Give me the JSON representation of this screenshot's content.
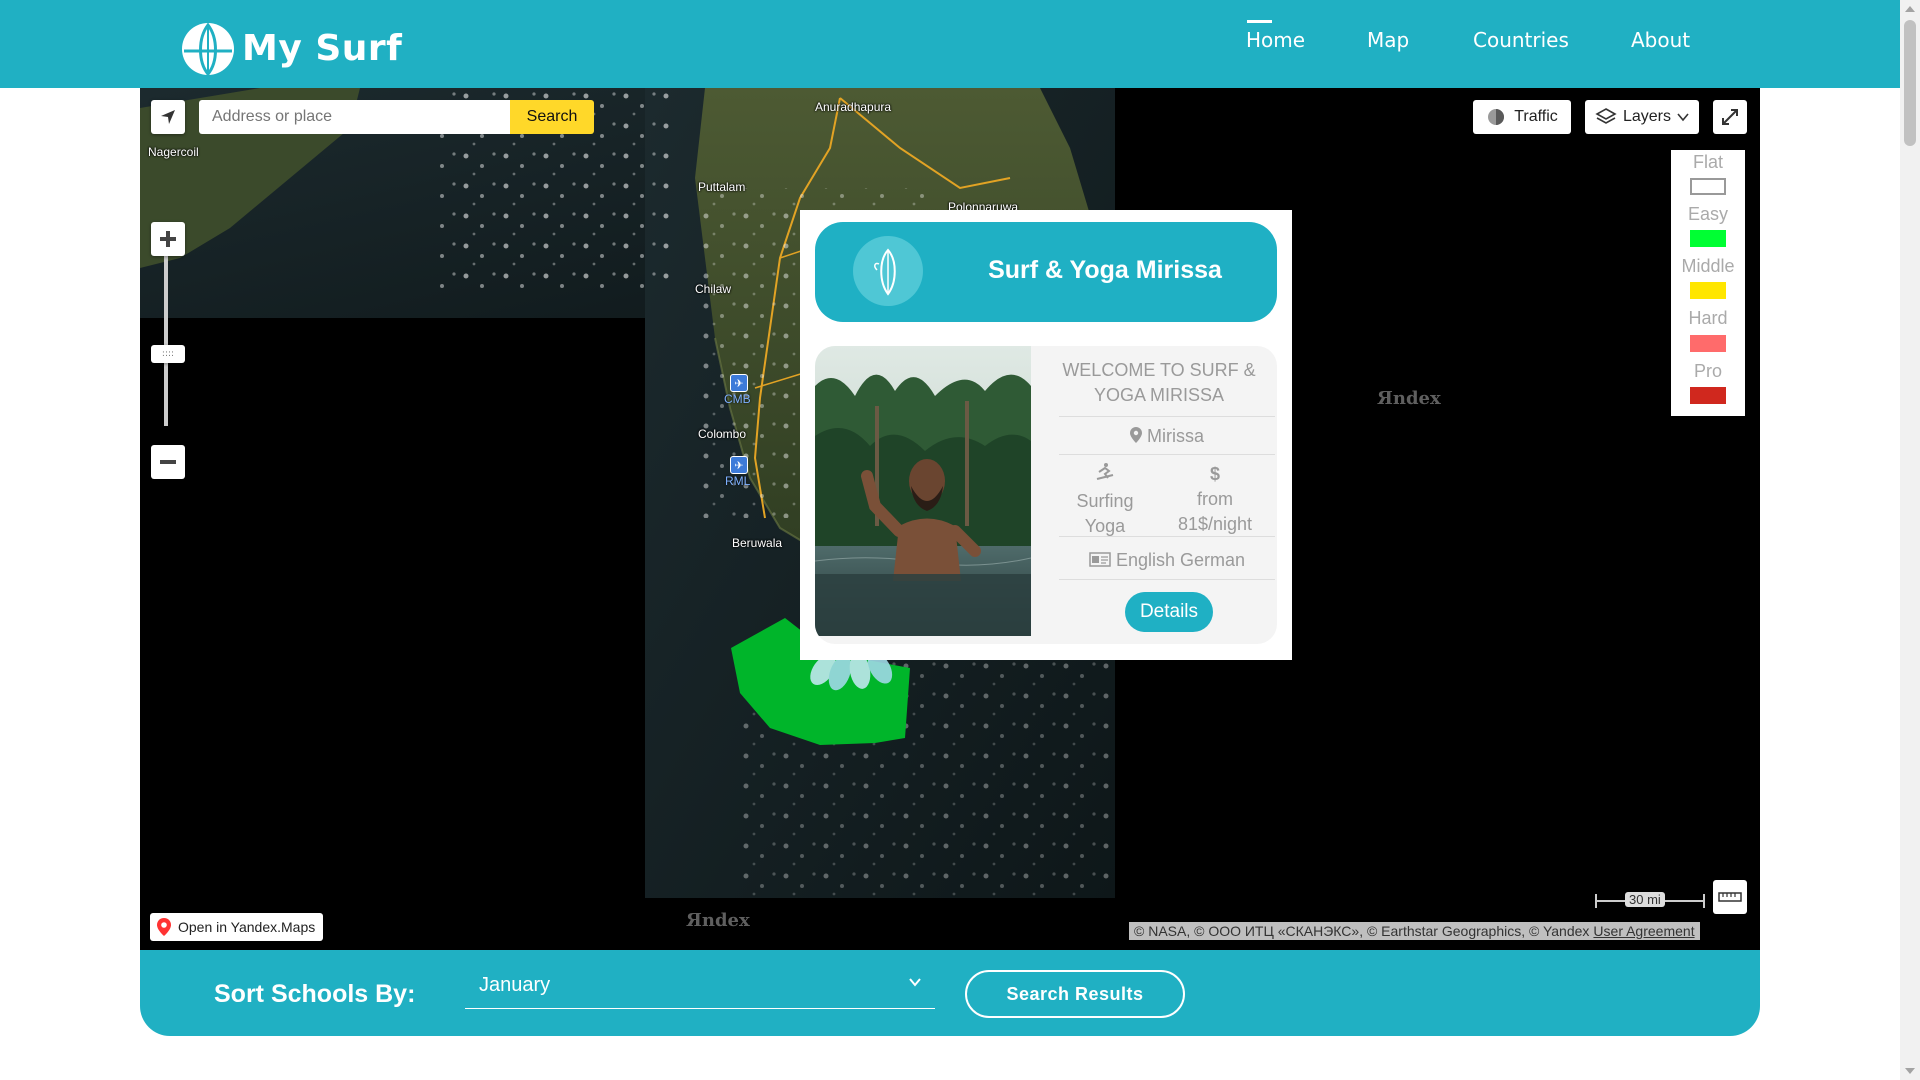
{
  "header": {
    "logo_text": "My Surf",
    "nav": [
      {
        "label": "Home",
        "active": true
      },
      {
        "label": "Map"
      },
      {
        "label": "Countries"
      },
      {
        "label": "About"
      }
    ]
  },
  "map": {
    "search": {
      "placeholder": "Address or place",
      "button_label": "Search"
    },
    "traffic_label": "Traffic",
    "layers_label": "Layers",
    "place_labels": {
      "anuradhapura": "Anuradhapura",
      "nagercoil": "Nagercoil",
      "puttalam": "Puttalam",
      "polonnaruwa": "Polonnaruwa",
      "chilaw": "Chilaw",
      "colombo": "Colombo",
      "beruwala": "Beruwala"
    },
    "airports": [
      "CMB",
      "RML"
    ],
    "legend": [
      {
        "label": "Flat",
        "color": "#ffffff"
      },
      {
        "label": "Easy",
        "color": "#00ff33"
      },
      {
        "label": "Middle",
        "color": "#ffe600"
      },
      {
        "label": "Hard",
        "color": "#ff6b6b"
      },
      {
        "label": "Pro",
        "color": "#d0281e"
      }
    ],
    "watermark": "Яndex",
    "scale_label": "30 mi",
    "open_in_yandex": "Open in Yandex.Maps",
    "copyright": "© NASA, © ООО ИТЦ «СКАНЭКС», © Earthstar Geographics, © Yandex",
    "user_agreement": "User Agreement"
  },
  "popup": {
    "title": "Surf & Yoga Mirissa",
    "welcome": "WELCOME TO SURF & YOGA MIRISSA",
    "location": "Mirissa",
    "activities": "Surfing Yoga",
    "price": "from 81$/night",
    "languages": "English German",
    "details_label": "Details"
  },
  "sort": {
    "label": "Sort Schools By:",
    "selected_month": "January",
    "results_label": "Search Results"
  },
  "colors": {
    "brand": "#20b0c3",
    "search_button": "#ffd829",
    "easy_zone": "#00b52a"
  }
}
